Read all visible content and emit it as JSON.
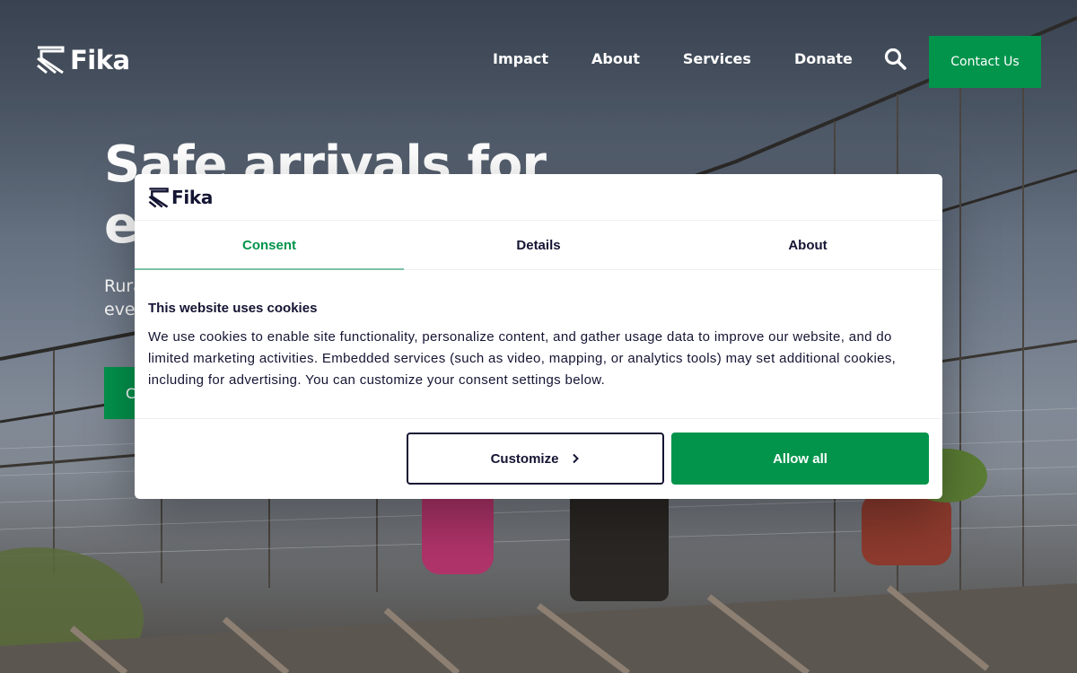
{
  "brand": {
    "name": "Fika",
    "accent": "#03944c",
    "ink": "#141433"
  },
  "header": {
    "nav": [
      "Impact",
      "About",
      "Services",
      "Donate"
    ],
    "search_icon": "search-icon",
    "contact_label": "Contact Us"
  },
  "hero": {
    "title": "Safe arrivals for every",
    "subtitle": "Rural communities deserve safe and reliable crossings for every",
    "cta_label": "Contact Us"
  },
  "cookie_modal": {
    "logo_text": "Fika",
    "tabs": [
      "Consent",
      "Details",
      "About"
    ],
    "active_tab": "Consent",
    "title": "This website uses cookies",
    "body": "We use cookies to enable site functionality, personalize content, and gather usage data to improve our website, and do limited marketing activities. Embedded services (such as video, mapping, or analytics tools) may set additional cookies, including for advertising. You can customize your consent settings below.",
    "customize_label": "Customize",
    "allow_all_label": "Allow all"
  }
}
